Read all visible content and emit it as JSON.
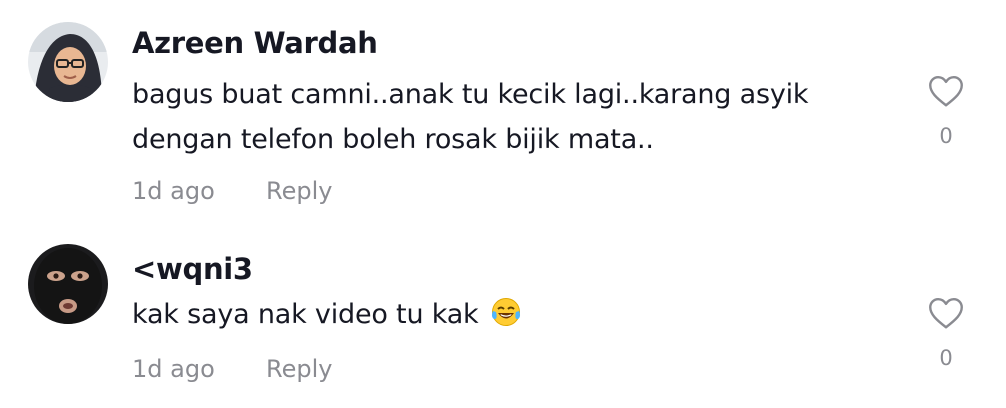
{
  "comments": [
    {
      "username": "Azreen Wardah",
      "text_line1": "bagus buat camni..anak tu kecik lagi..karang asyik",
      "text_line2": "dengan telefon boleh rosak bijik mata..",
      "time": "1d ago",
      "reply_label": "Reply",
      "like_count": "0",
      "avatar_icon": "user-avatar-hijab-glasses",
      "like_icon": "heart-outline-icon"
    },
    {
      "username": "<wqni3",
      "text": "kak saya nak video tu kak",
      "emoji_icon": "face-with-tears-of-joy-emoji",
      "time": "1d ago",
      "reply_label": "Reply",
      "like_count": "0",
      "avatar_icon": "user-avatar-balaclava",
      "like_icon": "heart-outline-icon"
    }
  ],
  "colors": {
    "primary_text": "#161823",
    "secondary_text": "#8a8b91",
    "background": "#ffffff"
  }
}
